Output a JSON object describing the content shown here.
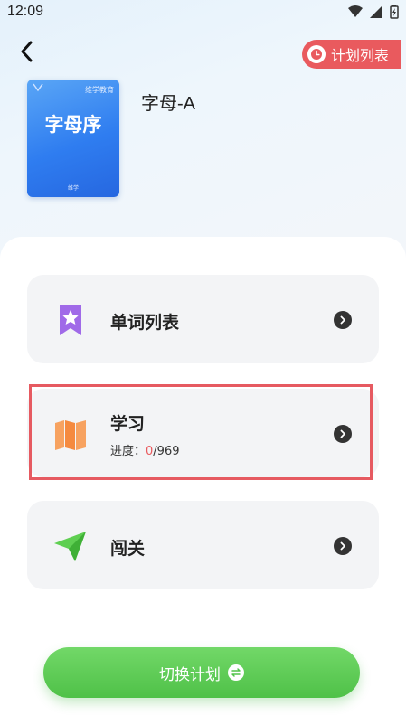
{
  "status": {
    "time": "12:09"
  },
  "header": {
    "plan_list_label": "计划列表"
  },
  "book": {
    "cover_publisher": "维学教育",
    "cover_title": "字母序",
    "cover_footer": "维学",
    "name": "字母-A"
  },
  "cards": [
    {
      "label": "单词列表",
      "icon": "bookmark-star-icon"
    },
    {
      "label": "学习",
      "progress_prefix": "进度：",
      "progress_current": "0",
      "progress_total": "/969",
      "icon": "map-icon"
    },
    {
      "label": "闯关",
      "icon": "paper-plane-icon"
    }
  ],
  "footer": {
    "switch_label": "切换计划"
  },
  "colors": {
    "accent_red": "#e95a5e",
    "green": "#52c44a",
    "blue": "#2f7df0"
  }
}
